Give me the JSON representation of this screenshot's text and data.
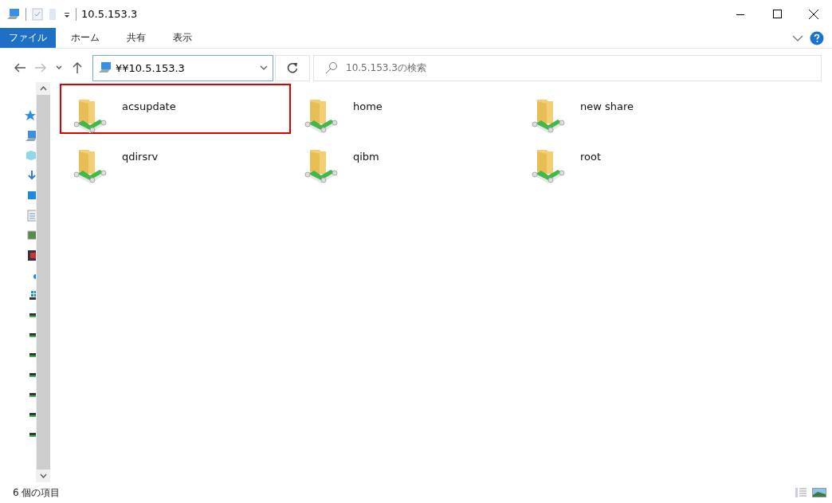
{
  "window": {
    "title": "10.5.153.3"
  },
  "ribbon": {
    "tabs": [
      {
        "label": "ファイル",
        "selected": true
      },
      {
        "label": "ホーム",
        "selected": false
      },
      {
        "label": "共有",
        "selected": false
      },
      {
        "label": "表示",
        "selected": false
      }
    ]
  },
  "address_bar": {
    "value": "¥¥10.5.153.3"
  },
  "search": {
    "placeholder": "10.5.153.3の検索"
  },
  "items": [
    {
      "name": "acsupdate",
      "highlighted": true
    },
    {
      "name": "home",
      "highlighted": false
    },
    {
      "name": "new share",
      "highlighted": false
    },
    {
      "name": "qdirsrv",
      "highlighted": false
    },
    {
      "name": "qibm",
      "highlighted": false
    },
    {
      "name": "root",
      "highlighted": false
    }
  ],
  "status_bar": {
    "text": "6 個の項目"
  }
}
